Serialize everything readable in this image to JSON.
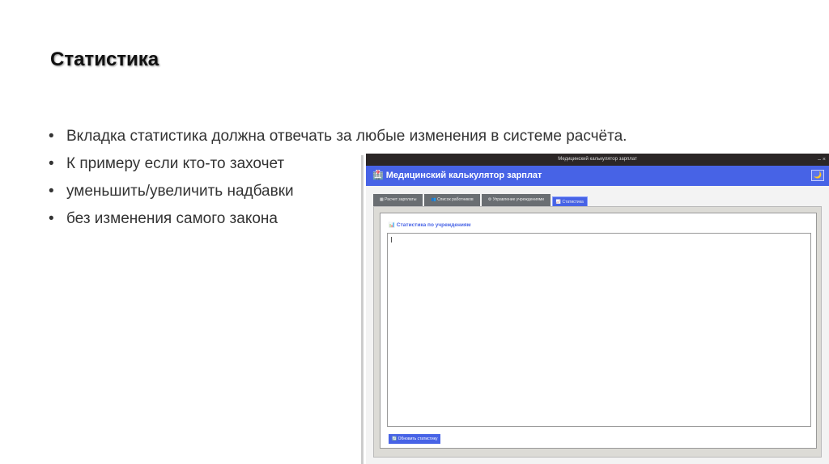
{
  "slide": {
    "title": "Статистика",
    "bullets": [
      "Вкладка статистика должна отвечать за любые изменения в системе расчёта.",
      "К примеру если кто-то захочет",
      "уменьшить/увеличить надбавки",
      "без изменения самого закона"
    ]
  },
  "window": {
    "title": "Медицинский калькулятор зарплат",
    "controls": "–  ×",
    "header": "🏥 Медицинский калькулятор зарплат",
    "theme_icon": "🌙",
    "tabs": [
      "▦ Расчет зарплаты",
      "👥 Список работников",
      "⚙ Управление учреждениями",
      "📈 Статистика"
    ],
    "active_tab": 3,
    "section_title": "📊 Статистика по учреждениям",
    "textarea_value": "",
    "refresh_button": "🔄 Обновить статистику",
    "accent": "#4763e6"
  }
}
